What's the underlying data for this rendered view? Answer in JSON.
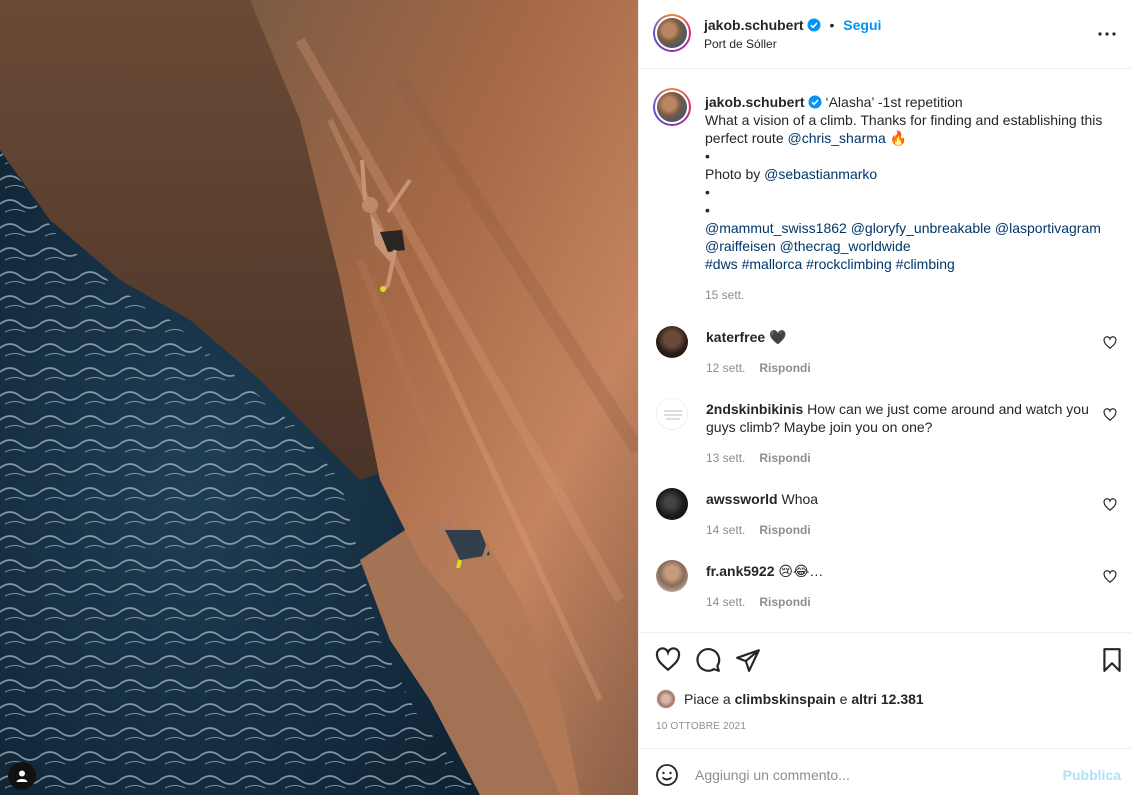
{
  "post": {
    "author": "jakob.schubert",
    "follow_label": "Segui",
    "separator": "•",
    "location": "Port de Sóller",
    "caption": {
      "intro": "‘Alasha’ -1st repetition",
      "line1_a": "What a vision of a climb. Thanks for finding and establishing this perfect route ",
      "mention_chris": "@chris_sharma",
      "emoji_fire": "🔥",
      "bullet": "•",
      "photo_by": "Photo by ",
      "mention_photographer": "@sebastianmarko",
      "sponsor_mentions": [
        "@mammut_swiss1862",
        "@gloryfy_unbreakable",
        "@lasportivagram",
        "@raiffeisen",
        "@thecrag_worldwide"
      ],
      "hashtags": [
        "#dws",
        "#mallorca",
        "#rockclimbing",
        "#climbing"
      ],
      "time": "15 sett."
    }
  },
  "comments": [
    {
      "user": "katerfree",
      "text": "🖤",
      "time": "12 sett.",
      "reply": "Rispondi"
    },
    {
      "user": "2ndskinbikinis",
      "text": "How can we just come around and watch you guys climb? Maybe join you on one?",
      "time": "13 sett.",
      "reply": "Rispondi"
    },
    {
      "user": "awssworld",
      "text": "Whoa",
      "time": "14 sett.",
      "reply": "Rispondi"
    },
    {
      "user": "fr.ank5922",
      "text": "😢😂…",
      "time": "14 sett.",
      "reply": "Rispondi"
    }
  ],
  "likes": {
    "prefix": "Piace a ",
    "user": "climbskinspain",
    "middle": " e ",
    "others": "altri 12.381"
  },
  "date": "10 OTTOBRE 2021",
  "comment_input": {
    "placeholder": "Aggiungi un commento...",
    "publish_label": "Pubblica"
  },
  "icons": {
    "verified": "verified-badge-icon",
    "more": "more-options-icon",
    "like": "heart-icon",
    "comment": "comment-bubble-icon",
    "share": "paper-plane-icon",
    "save": "bookmark-icon",
    "emoji": "smiley-icon",
    "tag": "user-tag-icon"
  },
  "colors": {
    "link": "#00376b",
    "follow": "#0095f6",
    "muted": "#8e8e8e",
    "publish_disabled": "#b2dffc"
  }
}
